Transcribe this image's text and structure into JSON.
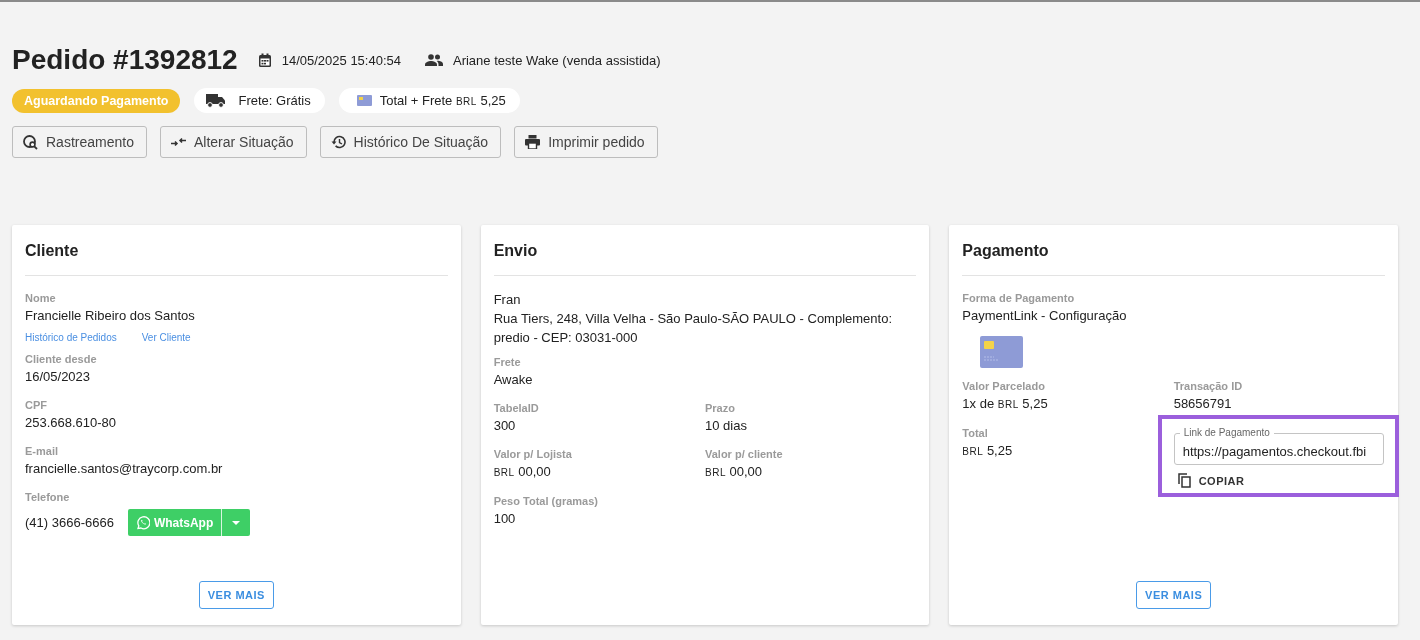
{
  "order": {
    "title": "Pedido #1392812",
    "date": "14/05/2025 15:40:54",
    "seller": "Ariane teste Wake (venda assistida)"
  },
  "badges": [
    {
      "kind": "status",
      "text": "Aguardando Pagamento"
    },
    {
      "kind": "shipping",
      "text": "Frete: Grátis"
    },
    {
      "kind": "total",
      "text": "Total + Frete",
      "currency": "BRL",
      "amount": "5,25"
    }
  ],
  "actions": [
    {
      "kind": "tracking",
      "label": "Rastreamento"
    },
    {
      "kind": "change",
      "label": "Alterar Situação"
    },
    {
      "kind": "history",
      "label": "Histórico De Situação"
    },
    {
      "kind": "print",
      "label": "Imprimir pedido"
    }
  ],
  "cliente": {
    "title": "Cliente",
    "name": {
      "label": "Nome",
      "value": "Francielle Ribeiro dos Santos"
    },
    "links": [
      "Histórico de Pedidos",
      "Ver Cliente"
    ],
    "fields": [
      {
        "label": "Cliente desde",
        "value": "16/05/2023"
      },
      {
        "label": "CPF",
        "value": "253.668.610-80"
      },
      {
        "label": "E-mail",
        "value": "francielle.santos@traycorp.com.br"
      }
    ],
    "phone": {
      "label": "Telefone",
      "value": "(41) 3666-6666",
      "button": "WhatsApp"
    },
    "more": "VER MAIS"
  },
  "envio": {
    "title": "Envio",
    "recipient": "Fran",
    "address": "Rua Tiers, 248, Villa Velha - São Paulo-SÃO PAULO - Complemento: predio - CEP: 03031-000",
    "fields": [
      {
        "kind": "full",
        "label": "Frete",
        "value": "Awake"
      },
      {
        "kind": "half",
        "label": "TabelaID",
        "value": "300"
      },
      {
        "kind": "half",
        "label": "Prazo",
        "value": "10 dias"
      },
      {
        "kind": "half",
        "label": "Valor p/ Lojista",
        "currency": "BRL",
        "value": "00,00"
      },
      {
        "kind": "half",
        "label": "Valor p/ cliente",
        "currency": "BRL",
        "value": "00,00"
      },
      {
        "kind": "full",
        "label": "Peso Total (gramas)",
        "value": "100"
      }
    ]
  },
  "pagamento": {
    "title": "Pagamento",
    "method": {
      "label": "Forma de Pagamento",
      "value": "PaymentLink - Configuração"
    },
    "installment": {
      "label": "Valor Parcelado",
      "prefix": "1x de",
      "currency": "BRL",
      "value": "5,25"
    },
    "transaction": {
      "label": "Transação ID",
      "value": "58656791"
    },
    "total": {
      "label": "Total",
      "currency": "BRL",
      "value": "5,25"
    },
    "link": {
      "label": "Link de Pagamento",
      "value": "https://pagamentos.checkout.fbi",
      "copy": "COPIAR"
    },
    "more": "VER MAIS"
  }
}
